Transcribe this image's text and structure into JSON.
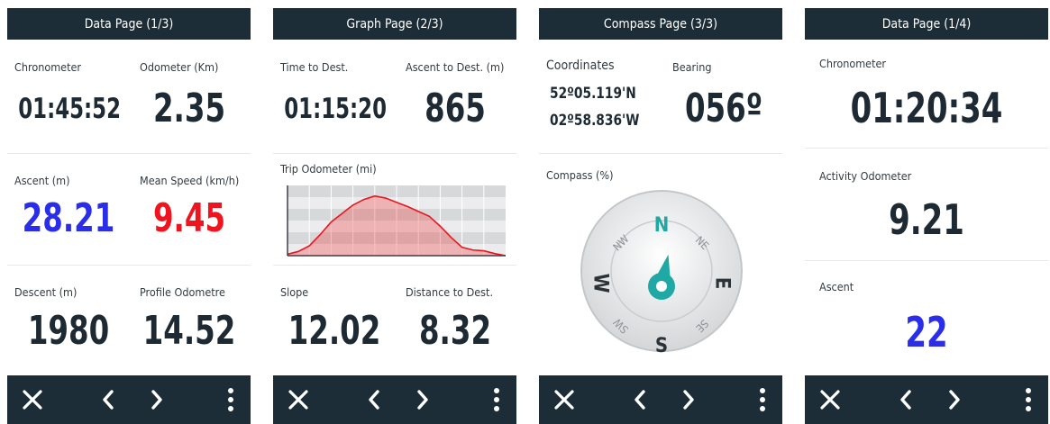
{
  "screens": [
    {
      "title": "Data Page (1/3)",
      "fields": [
        {
          "label": "Chronometer",
          "value": "01:45:52"
        },
        {
          "label": "Odometer (Km)",
          "value": "2.35"
        },
        {
          "label": "Ascent (m)",
          "value": "28.21"
        },
        {
          "label": "Mean Speed (km/h)",
          "value": "9.45"
        },
        {
          "label": "Descent (m)",
          "value": "1980"
        },
        {
          "label": "Profile Odometre",
          "value": "14.52"
        }
      ]
    },
    {
      "title": "Graph Page (2/3)",
      "fields": [
        {
          "label": "Time to Dest.",
          "value": "01:15:20"
        },
        {
          "label": "Ascent to Dest. (m)",
          "value": "865"
        },
        {
          "label": "Slope",
          "value": "12.02"
        },
        {
          "label": "Distance to Dest.",
          "value": "8.32"
        }
      ],
      "graph_label": "Trip Odometer (mi)"
    },
    {
      "title": "Compass Page (3/3)",
      "coordinates_label": "Coordinates",
      "lat": "52º05.119'N",
      "lon": "02º58.836'W",
      "bearing_label": "Bearing",
      "bearing_value": "056º",
      "compass_label": "Compass (%)",
      "dirs": {
        "n": "N",
        "s": "S",
        "e": "E",
        "w": "W",
        "ne": "NE",
        "nw": "NW",
        "se": "SE",
        "sw": "SW"
      }
    },
    {
      "title": "Data Page (1/4)",
      "fields": [
        {
          "label": "Chronometer",
          "value": "01:20:34"
        },
        {
          "label": "Activity Odometer",
          "value": "9.21"
        },
        {
          "label": "Ascent",
          "value": "22"
        }
      ]
    }
  ],
  "colors": {
    "header_bg": "#1d2d37",
    "blue_value": "#2b2ee8",
    "red_value": "#f0141e",
    "compass_teal": "#1fa8a4"
  },
  "footer_icons": [
    "close-icon",
    "chevron-left-icon",
    "chevron-right-icon",
    "more-vertical-icon"
  ],
  "chart_data": {
    "type": "area",
    "x": [
      0,
      1,
      2,
      3,
      4,
      5,
      6,
      7,
      8,
      9,
      10,
      11,
      12,
      13,
      14,
      15,
      16,
      17,
      18,
      19,
      20
    ],
    "values": [
      2,
      6,
      14,
      30,
      48,
      60,
      72,
      80,
      85,
      82,
      76,
      70,
      63,
      56,
      42,
      26,
      12,
      8,
      7,
      3,
      0
    ],
    "ylim": [
      0,
      100
    ]
  }
}
